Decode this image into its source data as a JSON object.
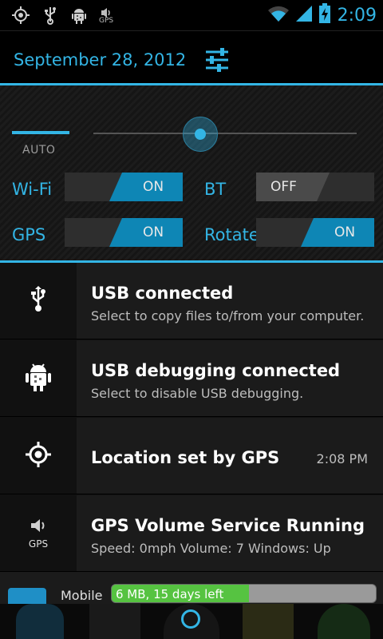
{
  "status_bar": {
    "left_icons": [
      "gps-target-icon",
      "usb-icon",
      "android-debug-icon",
      "gps-volume-icon"
    ],
    "gps_icon_text": "GPS",
    "right_icons": [
      "wifi-icon",
      "signal-icon",
      "battery-charging-icon"
    ],
    "time": "2:09"
  },
  "header": {
    "date": "September 28, 2012",
    "settings_icon": "settings-sliders-icon"
  },
  "brightness": {
    "auto_label": "AUTO",
    "level": 0.4
  },
  "toggles": [
    {
      "label": "Wi-Fi",
      "state": "ON"
    },
    {
      "label": "BT",
      "state": "OFF"
    },
    {
      "label": "GPS",
      "state": "ON"
    },
    {
      "label": "Rotate",
      "state": "ON"
    }
  ],
  "notifications": [
    {
      "icon": "usb-icon",
      "title": "USB connected",
      "subtitle": "Select to copy files to/from your computer.",
      "time": ""
    },
    {
      "icon": "android-debug-icon",
      "title": "USB debugging connected",
      "subtitle": "Select to disable USB debugging.",
      "time": ""
    },
    {
      "icon": "gps-target-icon",
      "title": "Location set by GPS",
      "subtitle": "",
      "time": "2:08 PM"
    },
    {
      "icon": "gps-volume-icon",
      "icon_text": "GPS",
      "title": "GPS Volume Service Running",
      "subtitle": "Speed: 0mph Volume: 7 Windows: Up",
      "time": ""
    }
  ],
  "mobile": {
    "label": "Mobile",
    "data_text": "6 MB, 15 days left",
    "data_fraction": 0.52
  },
  "colors": {
    "accent": "#33b5e5",
    "toggle_on": "#0e86b5",
    "data_green": "#56c341"
  }
}
